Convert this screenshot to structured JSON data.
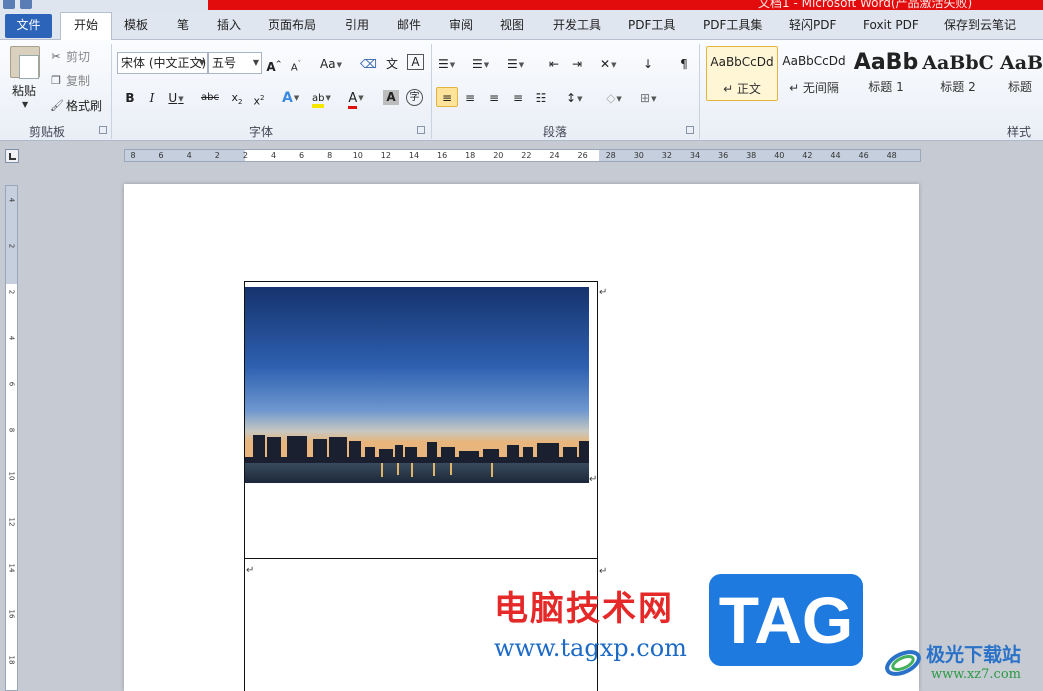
{
  "window": {
    "title": "文档1 - Microsoft Word(产品激活失败)"
  },
  "tabs": [
    "文件",
    "开始",
    "模板",
    "笔",
    "插入",
    "页面布局",
    "引用",
    "邮件",
    "审阅",
    "视图",
    "开发工具",
    "PDF工具",
    "PDF工具集",
    "轻闪PDF",
    "Foxit PDF",
    "保存到云笔记"
  ],
  "clipboard": {
    "paste": "粘贴",
    "cut": "剪切",
    "copy": "复制",
    "format_painter": "格式刷",
    "label": "剪贴板"
  },
  "font": {
    "name": "宋体 (中文正文)",
    "size": "五号",
    "label": "字体",
    "case": "Aa"
  },
  "paragraph": {
    "label": "段落"
  },
  "styles": {
    "label": "样式",
    "items": [
      {
        "preview": "AaBbCcDd",
        "name": "↵ 正文"
      },
      {
        "preview": "AaBbCcDd",
        "name": "↵ 无间隔"
      },
      {
        "preview": "AaBb",
        "name": "标题 1"
      },
      {
        "preview": "AaBbC",
        "name": "标题 2"
      },
      {
        "preview": "AaBl",
        "name": "标题"
      }
    ]
  },
  "ruler": {
    "h_ticks": [
      "8",
      "6",
      "4",
      "2",
      "2",
      "4",
      "6",
      "8",
      "10",
      "12",
      "14",
      "16",
      "18",
      "20",
      "22",
      "24",
      "26",
      "28",
      "30",
      "32",
      "34",
      "36",
      "38",
      "40",
      "42",
      "44",
      "46",
      "48"
    ],
    "v_ticks": [
      "4",
      "2",
      "2",
      "4",
      "6",
      "8",
      "10",
      "12",
      "14",
      "16",
      "18"
    ]
  },
  "document": {
    "paragraph_mark": "↵"
  },
  "watermark": {
    "cn": "电脑技术网",
    "url": "www.tagxp.com",
    "tag": "TAG",
    "site": "极光下载站",
    "domain": "www.xz7.com"
  },
  "colors": {
    "file_tab": "#2b64b8",
    "title_bar": "#e20c0c",
    "highlight": "#fde49a"
  }
}
